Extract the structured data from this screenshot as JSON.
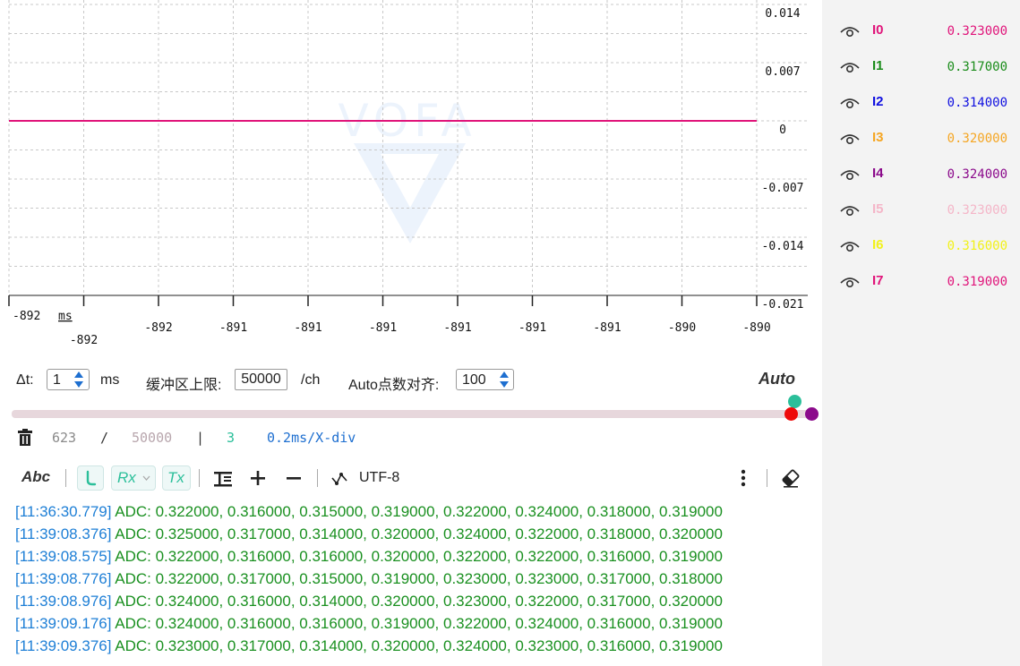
{
  "plot": {
    "y_ticks": [
      "0.014",
      "0.007",
      "0",
      "-0.007",
      "-0.014",
      "-0.021"
    ],
    "x_ticks": [
      "-892",
      "-892",
      "-892",
      "-891",
      "-891",
      "-891",
      "-891",
      "-891",
      "-891",
      "-890",
      "-890"
    ],
    "x_unit": "ms",
    "series_color": "#e0147a"
  },
  "chart_data": {
    "type": "line",
    "title": "",
    "xlabel": "ms",
    "ylabel": "",
    "ylim": [
      -0.021,
      0.014
    ],
    "x_tick_labels": [
      "-892",
      "-892",
      "-892",
      "-891",
      "-891",
      "-891",
      "-891",
      "-891",
      "-891",
      "-890",
      "-890"
    ],
    "y_tick_labels": [
      "0.014",
      "0.007",
      "0",
      "-0.007",
      "-0.014",
      "-0.021"
    ],
    "series": [
      {
        "values": [
          0,
          0
        ]
      }
    ],
    "grid": true
  },
  "channels": [
    {
      "name": "I0",
      "value": "0.323000",
      "color": "#e0147a"
    },
    {
      "name": "I1",
      "value": "0.317000",
      "color": "#1a8c1a"
    },
    {
      "name": "I2",
      "value": "0.314000",
      "color": "#1010e0"
    },
    {
      "name": "I3",
      "value": "0.320000",
      "color": "#f5a623"
    },
    {
      "name": "I4",
      "value": "0.324000",
      "color": "#8b0a8b"
    },
    {
      "name": "I5",
      "value": "0.323000",
      "color": "#f4b6c8"
    },
    {
      "name": "I6",
      "value": "0.316000",
      "color": "#f2f21a"
    },
    {
      "name": "I7",
      "value": "0.319000",
      "color": "#e0147a"
    }
  ],
  "controls": {
    "dt_label": "Δt:",
    "dt_value": "1",
    "dt_unit": "ms",
    "buffer_label": "缓冲区上限:",
    "buffer_value": "50000",
    "buffer_unit": "/ch",
    "auto_align_label": "Auto点数对齐:",
    "auto_align_value": "100",
    "auto_label": "Auto"
  },
  "slider": {
    "position_fraction": 0.99,
    "knob_colors": {
      "top": "#2bbf9a",
      "left": "#ee0a0a",
      "right": "#8b0a8b"
    }
  },
  "stats": {
    "count": "623",
    "sep1": "/",
    "capacity": "50000",
    "sep2": "|",
    "channels": "3",
    "scale": "0.2ms/X-div"
  },
  "toolbar": {
    "abc_label": "Abc",
    "rx_label": "Rx",
    "tx_label": "Tx",
    "encoding_label": "UTF-8"
  },
  "log": [
    {
      "time": "[11:36:30.779]",
      "msg": "ADC: 0.322000, 0.316000, 0.315000, 0.319000, 0.322000, 0.324000, 0.318000, 0.319000"
    },
    {
      "time": "[11:39:08.376]",
      "msg": "ADC: 0.325000, 0.317000, 0.314000, 0.320000, 0.324000, 0.322000, 0.318000, 0.320000"
    },
    {
      "time": "[11:39:08.575]",
      "msg": "ADC: 0.322000, 0.316000, 0.316000, 0.320000, 0.322000, 0.322000, 0.316000, 0.319000"
    },
    {
      "time": "[11:39:08.776]",
      "msg": "ADC: 0.322000, 0.317000, 0.315000, 0.319000, 0.323000, 0.323000, 0.317000, 0.318000"
    },
    {
      "time": "[11:39:08.976]",
      "msg": "ADC: 0.324000, 0.316000, 0.314000, 0.320000, 0.323000, 0.322000, 0.317000, 0.320000"
    },
    {
      "time": "[11:39:09.176]",
      "msg": "ADC: 0.324000, 0.316000, 0.316000, 0.319000, 0.322000, 0.324000, 0.316000, 0.319000"
    },
    {
      "time": "[11:39:09.376]",
      "msg": "ADC: 0.323000, 0.317000, 0.314000, 0.320000, 0.324000, 0.323000, 0.316000, 0.319000"
    }
  ]
}
